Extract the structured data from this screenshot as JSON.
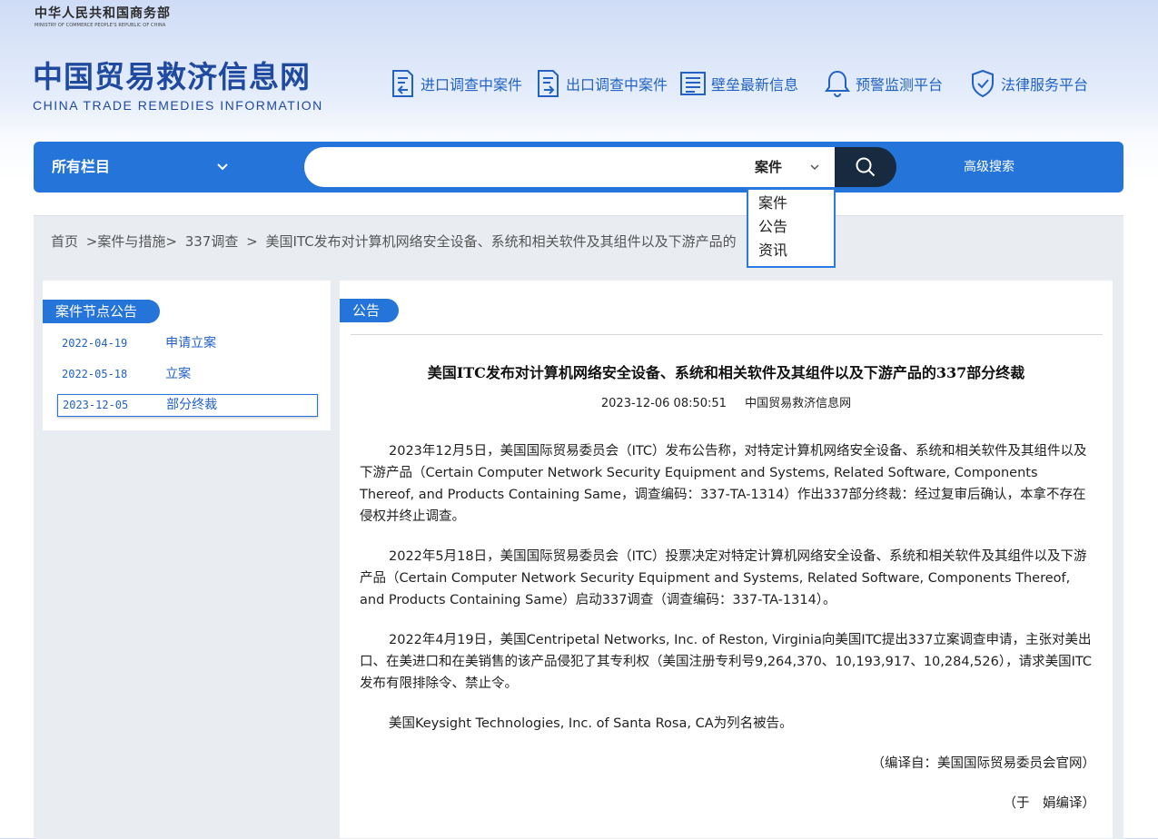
{
  "ministry": {
    "cn": "中华人民共和国商务部",
    "en": "MINISTRY OF COMMERCE PEOPLE'S REPUBLIC OF CHINA"
  },
  "site": {
    "cn": "中国贸易救济信息网",
    "en": "CHINA TRADE REMEDIES INFORMATION"
  },
  "nav": [
    {
      "label": "进口调查中案件",
      "icon": "import-document-icon"
    },
    {
      "label": "出口调查中案件",
      "icon": "export-document-icon"
    },
    {
      "label": "壁垒最新信息",
      "icon": "news-list-icon"
    },
    {
      "label": "预警监测平台",
      "icon": "bell-icon"
    },
    {
      "label": "法律服务平台",
      "icon": "shield-check-icon"
    }
  ],
  "search": {
    "category": "所有栏目",
    "type": "案件",
    "query": "",
    "advanced": "高级搜索",
    "type_options": [
      "案件",
      "公告",
      "资讯"
    ]
  },
  "breadcrumb": [
    "首页",
    ">案件与措施>",
    "337调查",
    ">",
    "美国ITC发布对计算机网络安全设备、系统和相关软件及其组件以及下游产品的"
  ],
  "sidebar": {
    "title": "案件节点公告",
    "items": [
      {
        "date": "2022-04-19",
        "label": "申请立案"
      },
      {
        "date": "2022-05-18",
        "label": "立案"
      },
      {
        "date": "2023-12-05",
        "label": "部分终裁"
      }
    ]
  },
  "article": {
    "tab": "公告",
    "title": "美国ITC发布对计算机网络安全设备、系统和相关软件及其组件以及下游产品的337部分终裁",
    "datetime": "2023-12-06 08:50:51",
    "source": "中国贸易救济信息网",
    "paragraphs": [
      "2023年12月5日，美国国际贸易委员会（ITC）发布公告称，对特定计算机网络安全设备、系统和相关软件及其组件以及下游产品（Certain Computer Network Security Equipment and Systems, Related Software, Components Thereof, and Products Containing Same，调查编码：337-TA-1314）作出337部分终裁：经过复审后确认，本拿不存在侵权并终止调查。",
      "2022年5月18日，美国国际贸易委员会（ITC）投票决定对特定计算机网络安全设备、系统和相关软件及其组件以及下游产品（Certain Computer Network Security Equipment and Systems, Related Software, Components Thereof, and Products Containing Same）启动337调查（调查编码：337-TA-1314）。",
      "2022年4月19日，美国Centripetal Networks, Inc. of Reston, Virginia向美国ITC提出337立案调查申请，主张对美出口、在美进口和在美销售的该产品侵犯了其专利权（美国注册专利号9,264,370、10,193,917、10,284,526），请求美国ITC发布有限排除令、禁止令。",
      "美国Keysight Technologies, Inc. of Santa Rosa, CA为列名被告。"
    ],
    "compiled_from": "（编译自：美国国际贸易委员会官网）",
    "translator": "（于　娟编译）"
  },
  "colors": {
    "brand_blue": "#2574d9",
    "nav_blue": "#2162c4",
    "search_button": "#172a3f"
  }
}
